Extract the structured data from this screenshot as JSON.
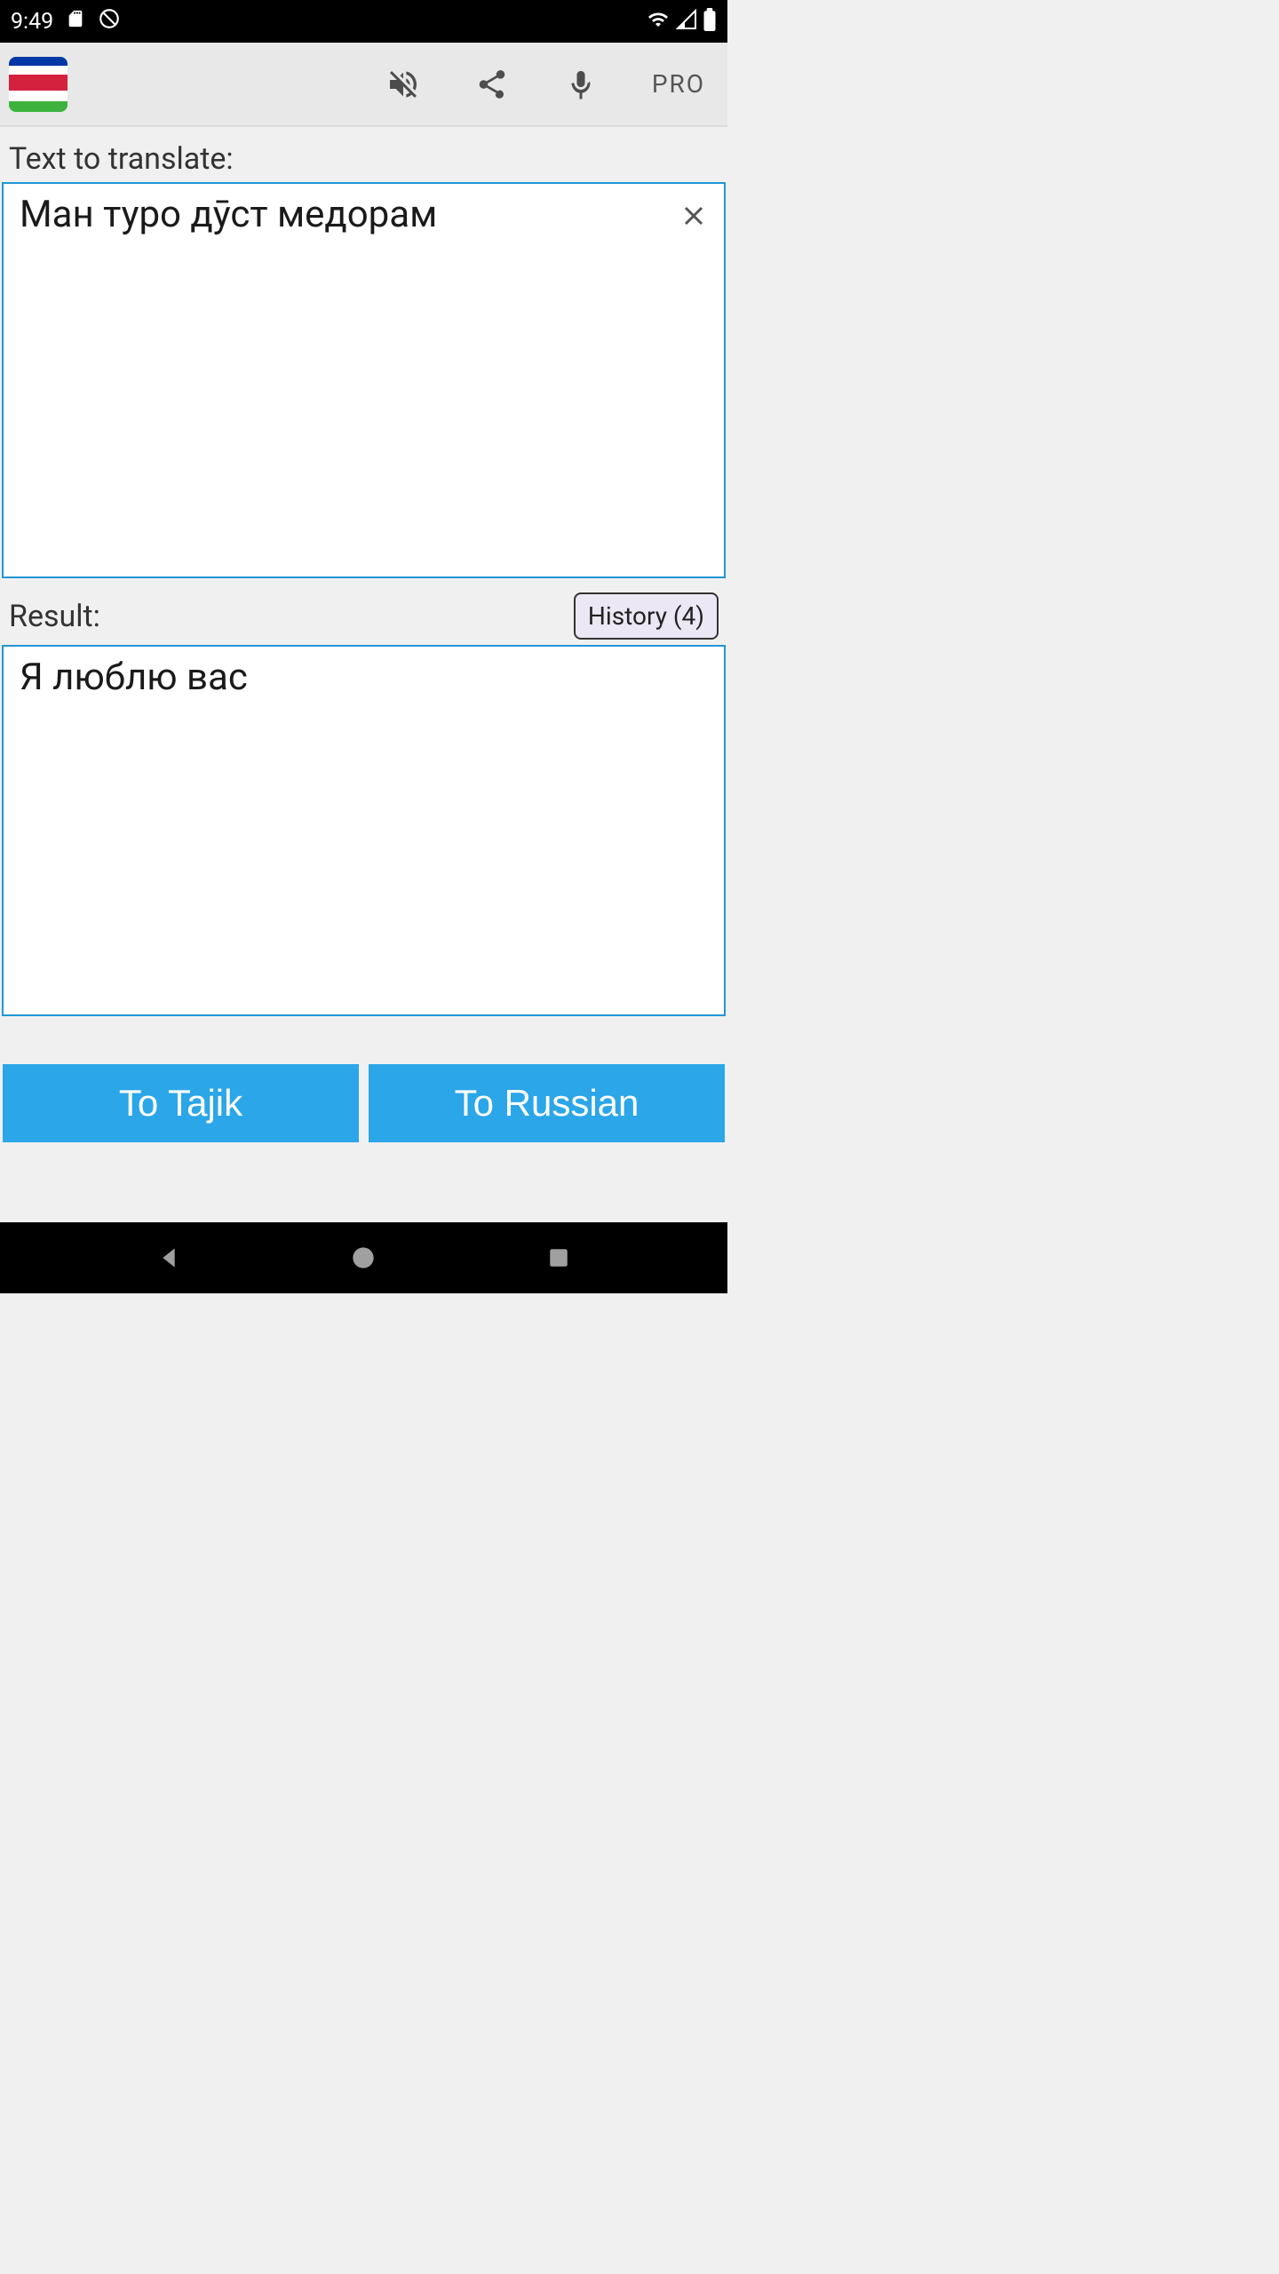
{
  "status_bar": {
    "time": "9:49"
  },
  "app_bar": {
    "pro_label": "PRO"
  },
  "input": {
    "label": "Text to translate:",
    "text": "Ман туро дӯст медорам"
  },
  "result": {
    "label": "Result:",
    "text": "Я люблю вас",
    "history_label": "History (4)"
  },
  "buttons": {
    "to_tajik": "To Tajik",
    "to_russian": "To Russian"
  }
}
